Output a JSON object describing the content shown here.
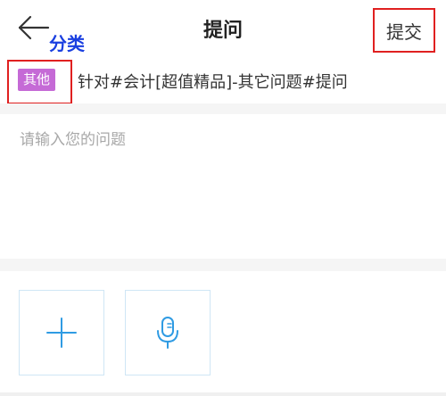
{
  "header": {
    "title": "提问",
    "submit_label": "提交",
    "annotation": "分类"
  },
  "category": {
    "tag": "其他",
    "path": "针对#会计[超值精品]-其它问题#提问"
  },
  "question": {
    "placeholder": "请输入您的问题",
    "value": ""
  },
  "attachments": {
    "add_icon": "plus-icon",
    "voice_icon": "microphone-icon"
  },
  "colors": {
    "annotation_blue": "#1a3fe0",
    "highlight_red": "#e02020",
    "tag_purple": "#c56ad6",
    "icon_blue": "#2f9be3"
  }
}
